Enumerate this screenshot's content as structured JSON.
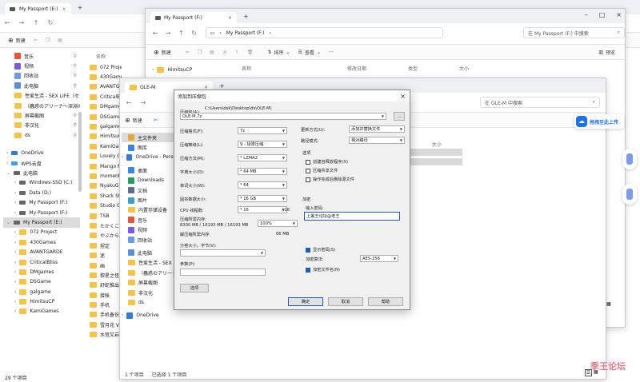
{
  "win1": {
    "tab_title": "My Passport (E:)",
    "toolbar": {
      "new_label": "新建"
    },
    "column_header": "名称",
    "quick_access": [
      "音乐",
      "视频",
      "回收站",
      "此电脑",
      "性爱生活 - SEX LIFE（セック",
      "（蟲惑のアリーナ〜深淵の",
      "屏幕截图",
      "非汉化",
      "ds"
    ],
    "tree": [
      "OneDrive",
      "WPS云盘",
      "此电脑",
      "Windows-SSD (C:)",
      "Data (D:)",
      "My Passport (F:)",
      "My Passport (F:)",
      "My Passport (E:)",
      "072 Project",
      "430Games",
      "AVANTGARDE",
      "CriticalBliss",
      "DMgames",
      "DSGame",
      "galgame",
      "HimitsuCP",
      "KamiGames"
    ],
    "files": [
      "072 Project",
      "430Games",
      "AVANTGARI",
      "CriticalBli",
      "DMgames",
      "DSGame",
      "galgame",
      "HimitsuCF",
      "KamiGame",
      "Lovely Ga",
      "Mango P",
      "moment",
      "NyakuG",
      "Shark St",
      "Studio G",
      "TSB",
      "たかくこ",
      "やぶから",
      "捏定",
      "迷",
      "画",
      "穆星之怪",
      "舒蛇推出",
      "接帐",
      "手机",
      "手机备份",
      "雪月花 V",
      "水恆又岩"
    ],
    "status": "29 个项目"
  },
  "win2": {
    "tab_title": "My Passport (F:)",
    "address": "My Passport (F:)",
    "search_placeholder": "在 My Passport (F:) 中搜索",
    "toolbar": {
      "new_label": "新建",
      "sort_label": "排序",
      "view_label": "查看",
      "preview_label": "预览"
    },
    "columns": [
      "名称",
      "修改日期",
      "类型",
      "大小"
    ],
    "first_item": "HimitsuCP"
  },
  "win3": {
    "tab_title": "OLE-M",
    "search_placeholder": "在 OLE-M 中搜索",
    "toolbar": {
      "new_label": "新建"
    },
    "size_col": "大小",
    "nav": [
      "主文件夹",
      "图库",
      "OneDrive - Perso",
      "桌面",
      "Downloads",
      "文档",
      "图片",
      "内置存储设备",
      "音乐",
      "视频",
      "回收站",
      "此电脑",
      "性爱生活 - SEX LIF",
      "（蟲惑のアリーナ",
      "屏幕截图",
      "非汉化",
      "ds",
      "OneDrive"
    ],
    "status_left": "1 个项目",
    "status_mid": "已选择 1 个项目"
  },
  "dialog": {
    "title": "添加到压缩包",
    "archive_label": "压缩包(A):",
    "archive_path": "C:\\Users\\dsk\\Desktop\\ds\\OLE-M\\",
    "archive_name": "OLE-M.7z",
    "browse_label": "...",
    "fields": [
      {
        "label": "压缩格式(F):",
        "value": "7z"
      },
      {
        "label": "压缩等级(L):",
        "value": "9 - 极限压缩"
      },
      {
        "label": "压缩方法(M):",
        "value": "* LZMA2"
      },
      {
        "label": "字典大小(D):",
        "value": "* 64 MB"
      },
      {
        "label": "单词大小(W):",
        "value": "* 64"
      },
      {
        "label": "固实数据大小:",
        "value": "* 16 GB"
      }
    ],
    "cpu_label": "CPU 线程数:",
    "cpu_value": "* 16",
    "cpu_total": "/ 16",
    "mem_label": "压缩所需内存:",
    "mem_detail": "8300 MB / 16193 MB / 16193 MB",
    "mem_percent": "100%",
    "decomp_label": "解压缩所需内存:",
    "decomp_value": "66 MB",
    "split_label": "分卷大小，字节(V):",
    "params_label": "参数(P):",
    "options_button": "选项",
    "update_label": "更新方式(U):",
    "update_value": "添加并替换文件",
    "path_label": "路径模式:",
    "path_value": "相对路径",
    "options_title": "选项",
    "option_checks": [
      {
        "label": "创建自释放程序(X)",
        "checked": false
      },
      {
        "label": "压缩共享文件",
        "checked": false
      },
      {
        "label": "操作完成后删除源文件",
        "checked": false
      }
    ],
    "encryption_title": "加密",
    "password_label": "输入密码:",
    "password_value": "上差王论坛@老王",
    "show_password": "显示密码(S)",
    "method_label": "加密算法:",
    "method_value": "AES-256",
    "encrypt_names": "加密文件名(N)",
    "ok": "确定",
    "cancel": "取消",
    "help": "帮助"
  },
  "side_widget": {
    "upload_label": "拖拽至此上传"
  },
  "watermark": "季王论坛",
  "colors": {
    "folder": "#f4c348",
    "accent": "#1a73e8",
    "selection": "#dcdcdc"
  }
}
